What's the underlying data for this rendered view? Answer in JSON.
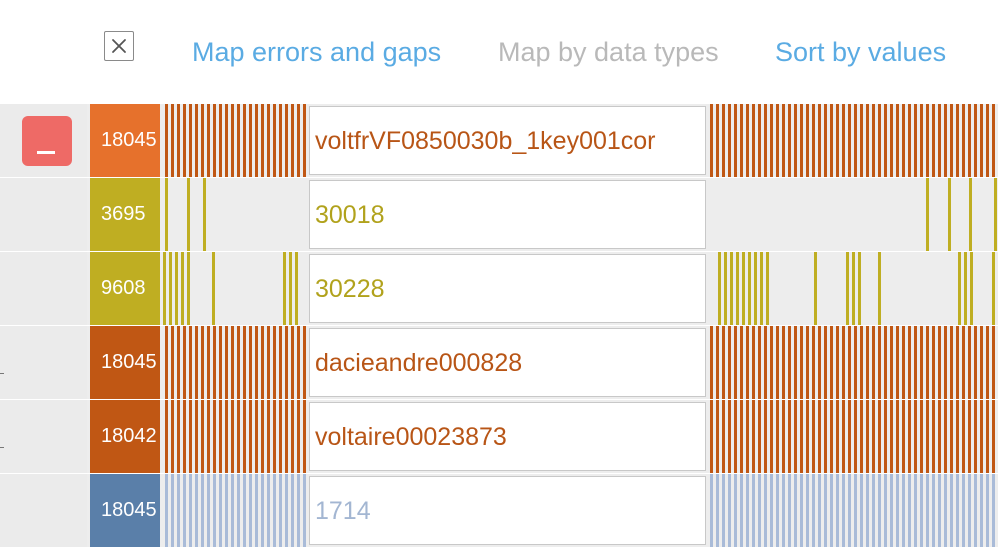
{
  "toolbar": {
    "close_icon": "close-x-icon",
    "map_errors_label": "Map errors and gaps",
    "map_types_label": "Map by data types",
    "sort_values_label": "Sort by values",
    "link_color": "#5aabe3",
    "disabled_color": "#b9b9b9"
  },
  "remove_button": {
    "label": "_",
    "color": "#ee6a66",
    "icon": "minus-icon"
  },
  "rows": [
    {
      "count": "18045",
      "value": "voltfrVF0850030b_1key001cor",
      "count_bg": "#e6712c",
      "stripe_color": "#c05714",
      "text_color": "#b85516",
      "pattern": "full",
      "selected": true
    },
    {
      "count": "3695",
      "value": "30018",
      "count_bg": "#bfae22",
      "stripe_color": "#bfae22",
      "text_color": "#b1a21c",
      "pattern": "sparse-a"
    },
    {
      "count": "9608",
      "value": "30228",
      "count_bg": "#bfae22",
      "stripe_color": "#bfae22",
      "text_color": "#b1a21c",
      "pattern": "sparse-b"
    },
    {
      "count": "18045",
      "value": "dacieandre000828",
      "count_bg": "#c05714",
      "stripe_color": "#c05714",
      "text_color": "#b85516",
      "pattern": "full"
    },
    {
      "count": "18042",
      "value": "voltaire00023873",
      "count_bg": "#c05714",
      "stripe_color": "#c05714",
      "text_color": "#b85516",
      "pattern": "full"
    },
    {
      "count": "18045",
      "value": "1714",
      "count_bg": "#5a7fa9",
      "stripe_color": "#a9bbd8",
      "text_color": "#a3b6d2",
      "pattern": "full"
    }
  ]
}
